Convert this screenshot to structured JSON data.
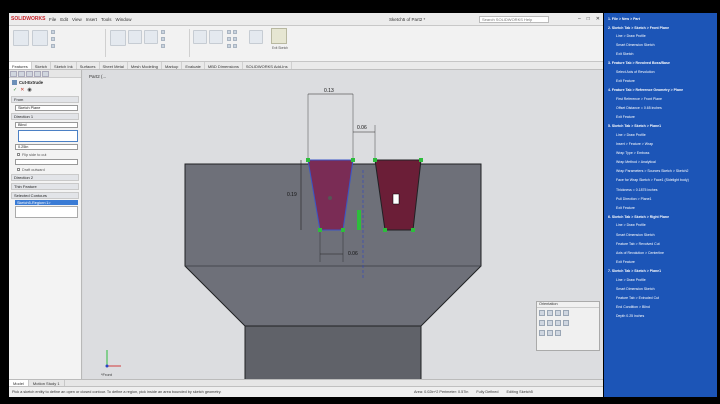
{
  "app": {
    "brand": "SOLIDWORKS",
    "menus": [
      "File",
      "Edit",
      "View",
      "Insert",
      "Tools",
      "Window"
    ],
    "doc_title": "Sketch5 of Part2 *",
    "search_placeholder": "Search SOLIDWORKS Help"
  },
  "ribbon": {
    "exit_sketch_label": "Exit Sketch"
  },
  "tabs": [
    "Features",
    "Sketch",
    "Sketch Ink",
    "Surfaces",
    "Sheet Metal",
    "Mesh Modeling",
    "Markup",
    "Evaluate",
    "MBD Dimensions",
    "SOLIDWORKS Add-Ins"
  ],
  "active_tab": "Features",
  "property_manager": {
    "title": "Cut-Extrude",
    "from_label": "From",
    "from_value": "Sketch Plane",
    "direction1_label": "Direction 1",
    "end_condition": "Blind",
    "depth": "0.25in",
    "flip_side": "Flip side to cut",
    "draft": "Draft outward",
    "direction2_label": "Direction 2",
    "thin_label": "Thin Feature",
    "selected_contours_label": "Selected Contours",
    "selected_item": "Sketch5-Region<1>"
  },
  "viewport": {
    "breadcrumb": "Part2 (...",
    "dim_top": "0.13",
    "dim_right_top": "0.06",
    "dim_left": "0.19",
    "dim_bottom": "0.06",
    "view_label": "*Front",
    "floating_toolbar_title": "Orientation"
  },
  "bottom_tabs": [
    "Model",
    "Motion Study 1"
  ],
  "status": {
    "message": "Pick a sketch entity to define an open or closed contour. To define a region, pick inside an area bounded by sketch geometry.",
    "area": "Area: 0.02in^2  Perimeter: 0.57in",
    "state": "Fully Defined",
    "editing": "Editing Sketch5"
  },
  "notes": [
    {
      "step": "1. File > New > Part",
      "subs": []
    },
    {
      "step": "2. Sketch Tab > Sketch > Front Plane",
      "subs": [
        "Line > Draw Profile",
        "Smart Dimension Sketch",
        "Exit Sketch"
      ]
    },
    {
      "step": "3. Feature Tab > Revolved Boss/Base",
      "subs": [
        "Select Axis of Revolution",
        "Exit Feature"
      ]
    },
    {
      "step": "4. Feature Tab > Reference Geometry > Plane",
      "subs": [
        "First Reference > Front Plane",
        "Offset Distance = 0.65 inches",
        "Exit Feature"
      ]
    },
    {
      "step": "5. Sketch Tab > Sketch > Plane1",
      "subs": [
        "Line > Draw Profile",
        "Insert > Feature > Wrap",
        "Wrap Type > Emboss",
        "Wrap Method > Analytical",
        "Wrap Parameters > Sources Sketch > Sketch2",
        "Face for Wrap Sketch > Face1 (Sidelight body)",
        "Thickness = 0.1875 inches",
        "Pull Direction > Plane1",
        "Exit Feature"
      ]
    },
    {
      "step": "6. Sketch Tab > Sketch > Right Plane",
      "subs": [
        "Line > Draw Profile",
        "Smart Dimension Sketch",
        "Feature Tab > Revolved Cut",
        "Axis of Revolution > Centerline",
        "Exit Feature"
      ]
    },
    {
      "step": "7. Sketch Tab > Sketch > Plane1",
      "subs": [
        "Line > Draw Profile",
        "Smart Dimension Sketch",
        "Feature Tab > Extruded Cut",
        "End Condition > Blind",
        "Depth 0.25 inches"
      ]
    }
  ]
}
